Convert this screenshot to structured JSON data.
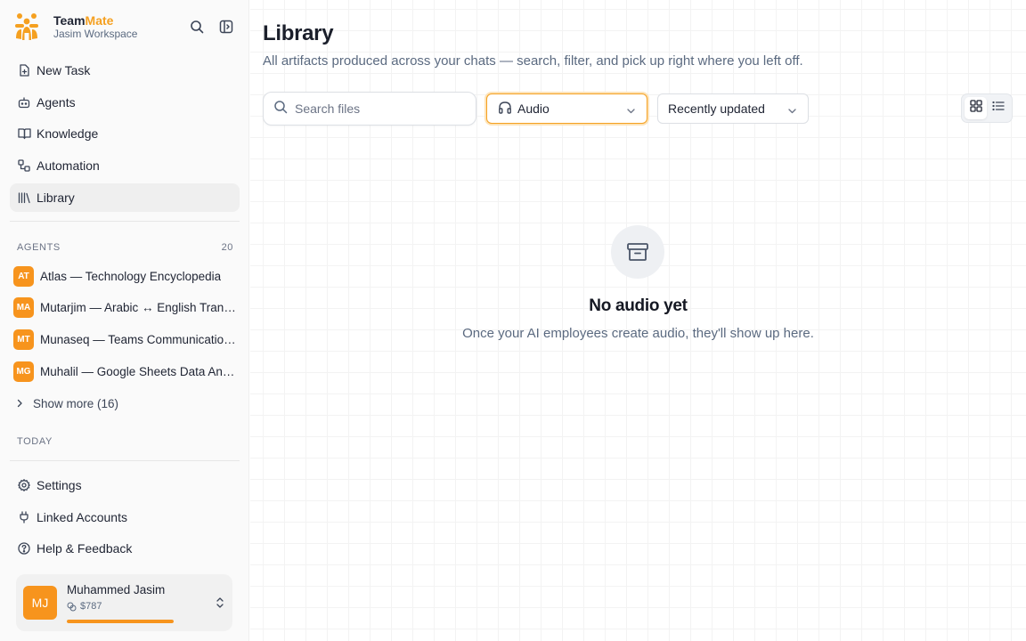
{
  "brand": {
    "name_part1": "Team",
    "name_part2": "Mate",
    "workspace": "Jasim Workspace",
    "accent_color": "#f5a020"
  },
  "top_icons": [
    "search-icon",
    "sidebar-toggle-icon"
  ],
  "nav": [
    {
      "label": "New Task",
      "icon": "new-task-icon"
    },
    {
      "label": "Agents",
      "icon": "bot-icon"
    },
    {
      "label": "Knowledge",
      "icon": "book-icon"
    },
    {
      "label": "Automation",
      "icon": "workflow-icon"
    },
    {
      "label": "Library",
      "icon": "library-icon",
      "active": true
    }
  ],
  "agents_section": {
    "title": "AGENTS",
    "count": "20"
  },
  "agents": [
    {
      "initials": "AT",
      "name": "Atlas — Technology Encyclopedia"
    },
    {
      "initials": "MA",
      "name": "Mutarjim — Arabic ↔ English Translator"
    },
    {
      "initials": "MT",
      "name": "Munaseq — Teams Communication Coordinator"
    },
    {
      "initials": "MG",
      "name": "Muhalil — Google Sheets Data Analyst"
    }
  ],
  "show_more": "Show more (16)",
  "today_section": {
    "title": "TODAY"
  },
  "bottom_nav": [
    {
      "label": "Settings",
      "icon": "gear-icon"
    },
    {
      "label": "Linked Accounts",
      "icon": "plug-icon"
    },
    {
      "label": "Help & Feedback",
      "icon": "help-icon"
    }
  ],
  "user": {
    "initials": "MJ",
    "name": "Muhammed Jasim",
    "balance": "$787",
    "balance_fraction": 1.0
  },
  "main": {
    "title": "Library",
    "subtitle": "All artifacts produced across your chats — search, filter, and pick up right where you left off.",
    "search_placeholder": "Search files",
    "type_filter": "Audio",
    "sort": "Recently updated",
    "view_mode": "grid"
  },
  "empty_state": {
    "title": "No audio yet",
    "message": "Once your AI employees create audio, they'll show up here."
  }
}
